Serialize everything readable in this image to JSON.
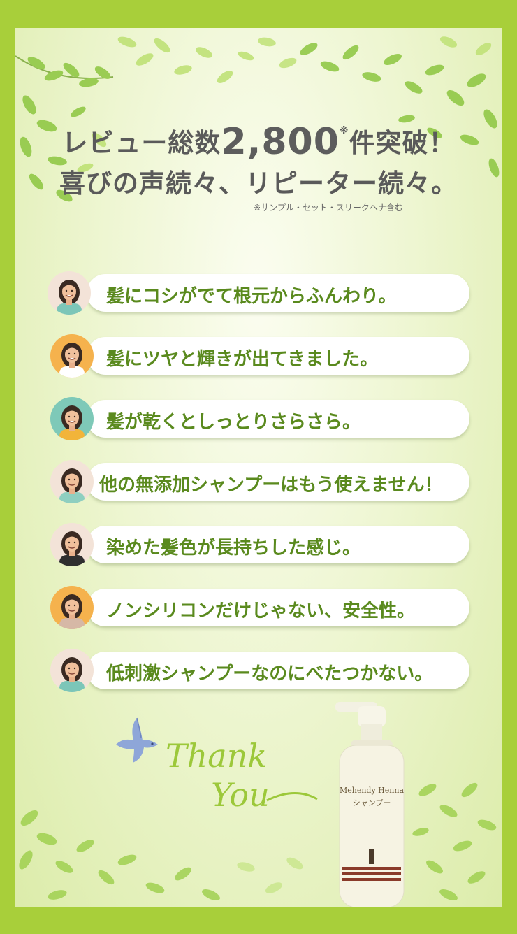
{
  "headline": {
    "line1_prefix": "レビュー総数",
    "line1_number": "2,800",
    "line1_mark": "※",
    "line1_suffix": "件突破！",
    "line2": "喜びの声続々、リピーター続々。",
    "note": "※サンプル・セット・スリークヘナ含む"
  },
  "reviews": [
    {
      "text": "髪にコシがでて根元からふんわり。",
      "avatar_bg": "#f3e3d8",
      "hair": "#3a2a22",
      "shirt": "#7cc6b8"
    },
    {
      "text": "髪にツヤと輝きが出てきました。",
      "avatar_bg": "#f5b24d",
      "hair": "#3a2a22",
      "shirt": "#ffffff"
    },
    {
      "text": "髪が乾くとしっとりさらさら。",
      "avatar_bg": "#7ec9b8",
      "hair": "#3a2a22",
      "shirt": "#f2b43a"
    },
    {
      "text": "他の無添加シャンプーはもう使えません！",
      "avatar_bg": "#f3e3d8",
      "hair": "#3a2a22",
      "shirt": "#8fcfc0"
    },
    {
      "text": "染めた髪色が長持ちした感じ。",
      "avatar_bg": "#f3e3d8",
      "hair": "#3a2a22",
      "shirt": "#2f2f2f"
    },
    {
      "text": "ノンシリコンだけじゃない、安全性。",
      "avatar_bg": "#f5b24d",
      "hair": "#3a2a22",
      "shirt": "#d6b8a6"
    },
    {
      "text": "低刺激シャンプーなのにべたつかない。",
      "avatar_bg": "#f3e3d8",
      "hair": "#3a2a22",
      "shirt": "#7cc6b8"
    }
  ],
  "thank_you": {
    "line1": "Thank",
    "line2": "You"
  },
  "product": {
    "brand": "Mehendy Henna",
    "type": "シャンプー"
  },
  "colors": {
    "frame": "#a8cf3a",
    "accent_text": "#5a8a1e",
    "headline_text": "#5a5a5a",
    "script_text": "#9cc83a"
  }
}
